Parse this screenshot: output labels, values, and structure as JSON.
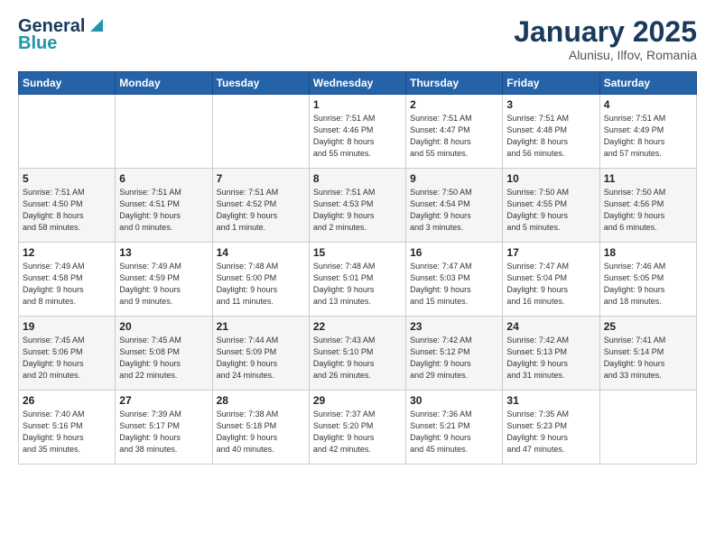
{
  "header": {
    "logo_line1": "General",
    "logo_line2": "Blue",
    "month": "January 2025",
    "location": "Alunisu, Ilfov, Romania"
  },
  "weekdays": [
    "Sunday",
    "Monday",
    "Tuesday",
    "Wednesday",
    "Thursday",
    "Friday",
    "Saturday"
  ],
  "weeks": [
    [
      {
        "day": "",
        "info": ""
      },
      {
        "day": "",
        "info": ""
      },
      {
        "day": "",
        "info": ""
      },
      {
        "day": "1",
        "info": "Sunrise: 7:51 AM\nSunset: 4:46 PM\nDaylight: 8 hours\nand 55 minutes."
      },
      {
        "day": "2",
        "info": "Sunrise: 7:51 AM\nSunset: 4:47 PM\nDaylight: 8 hours\nand 55 minutes."
      },
      {
        "day": "3",
        "info": "Sunrise: 7:51 AM\nSunset: 4:48 PM\nDaylight: 8 hours\nand 56 minutes."
      },
      {
        "day": "4",
        "info": "Sunrise: 7:51 AM\nSunset: 4:49 PM\nDaylight: 8 hours\nand 57 minutes."
      }
    ],
    [
      {
        "day": "5",
        "info": "Sunrise: 7:51 AM\nSunset: 4:50 PM\nDaylight: 8 hours\nand 58 minutes."
      },
      {
        "day": "6",
        "info": "Sunrise: 7:51 AM\nSunset: 4:51 PM\nDaylight: 9 hours\nand 0 minutes."
      },
      {
        "day": "7",
        "info": "Sunrise: 7:51 AM\nSunset: 4:52 PM\nDaylight: 9 hours\nand 1 minute."
      },
      {
        "day": "8",
        "info": "Sunrise: 7:51 AM\nSunset: 4:53 PM\nDaylight: 9 hours\nand 2 minutes."
      },
      {
        "day": "9",
        "info": "Sunrise: 7:50 AM\nSunset: 4:54 PM\nDaylight: 9 hours\nand 3 minutes."
      },
      {
        "day": "10",
        "info": "Sunrise: 7:50 AM\nSunset: 4:55 PM\nDaylight: 9 hours\nand 5 minutes."
      },
      {
        "day": "11",
        "info": "Sunrise: 7:50 AM\nSunset: 4:56 PM\nDaylight: 9 hours\nand 6 minutes."
      }
    ],
    [
      {
        "day": "12",
        "info": "Sunrise: 7:49 AM\nSunset: 4:58 PM\nDaylight: 9 hours\nand 8 minutes."
      },
      {
        "day": "13",
        "info": "Sunrise: 7:49 AM\nSunset: 4:59 PM\nDaylight: 9 hours\nand 9 minutes."
      },
      {
        "day": "14",
        "info": "Sunrise: 7:48 AM\nSunset: 5:00 PM\nDaylight: 9 hours\nand 11 minutes."
      },
      {
        "day": "15",
        "info": "Sunrise: 7:48 AM\nSunset: 5:01 PM\nDaylight: 9 hours\nand 13 minutes."
      },
      {
        "day": "16",
        "info": "Sunrise: 7:47 AM\nSunset: 5:03 PM\nDaylight: 9 hours\nand 15 minutes."
      },
      {
        "day": "17",
        "info": "Sunrise: 7:47 AM\nSunset: 5:04 PM\nDaylight: 9 hours\nand 16 minutes."
      },
      {
        "day": "18",
        "info": "Sunrise: 7:46 AM\nSunset: 5:05 PM\nDaylight: 9 hours\nand 18 minutes."
      }
    ],
    [
      {
        "day": "19",
        "info": "Sunrise: 7:45 AM\nSunset: 5:06 PM\nDaylight: 9 hours\nand 20 minutes."
      },
      {
        "day": "20",
        "info": "Sunrise: 7:45 AM\nSunset: 5:08 PM\nDaylight: 9 hours\nand 22 minutes."
      },
      {
        "day": "21",
        "info": "Sunrise: 7:44 AM\nSunset: 5:09 PM\nDaylight: 9 hours\nand 24 minutes."
      },
      {
        "day": "22",
        "info": "Sunrise: 7:43 AM\nSunset: 5:10 PM\nDaylight: 9 hours\nand 26 minutes."
      },
      {
        "day": "23",
        "info": "Sunrise: 7:42 AM\nSunset: 5:12 PM\nDaylight: 9 hours\nand 29 minutes."
      },
      {
        "day": "24",
        "info": "Sunrise: 7:42 AM\nSunset: 5:13 PM\nDaylight: 9 hours\nand 31 minutes."
      },
      {
        "day": "25",
        "info": "Sunrise: 7:41 AM\nSunset: 5:14 PM\nDaylight: 9 hours\nand 33 minutes."
      }
    ],
    [
      {
        "day": "26",
        "info": "Sunrise: 7:40 AM\nSunset: 5:16 PM\nDaylight: 9 hours\nand 35 minutes."
      },
      {
        "day": "27",
        "info": "Sunrise: 7:39 AM\nSunset: 5:17 PM\nDaylight: 9 hours\nand 38 minutes."
      },
      {
        "day": "28",
        "info": "Sunrise: 7:38 AM\nSunset: 5:18 PM\nDaylight: 9 hours\nand 40 minutes."
      },
      {
        "day": "29",
        "info": "Sunrise: 7:37 AM\nSunset: 5:20 PM\nDaylight: 9 hours\nand 42 minutes."
      },
      {
        "day": "30",
        "info": "Sunrise: 7:36 AM\nSunset: 5:21 PM\nDaylight: 9 hours\nand 45 minutes."
      },
      {
        "day": "31",
        "info": "Sunrise: 7:35 AM\nSunset: 5:23 PM\nDaylight: 9 hours\nand 47 minutes."
      },
      {
        "day": "",
        "info": ""
      }
    ]
  ]
}
